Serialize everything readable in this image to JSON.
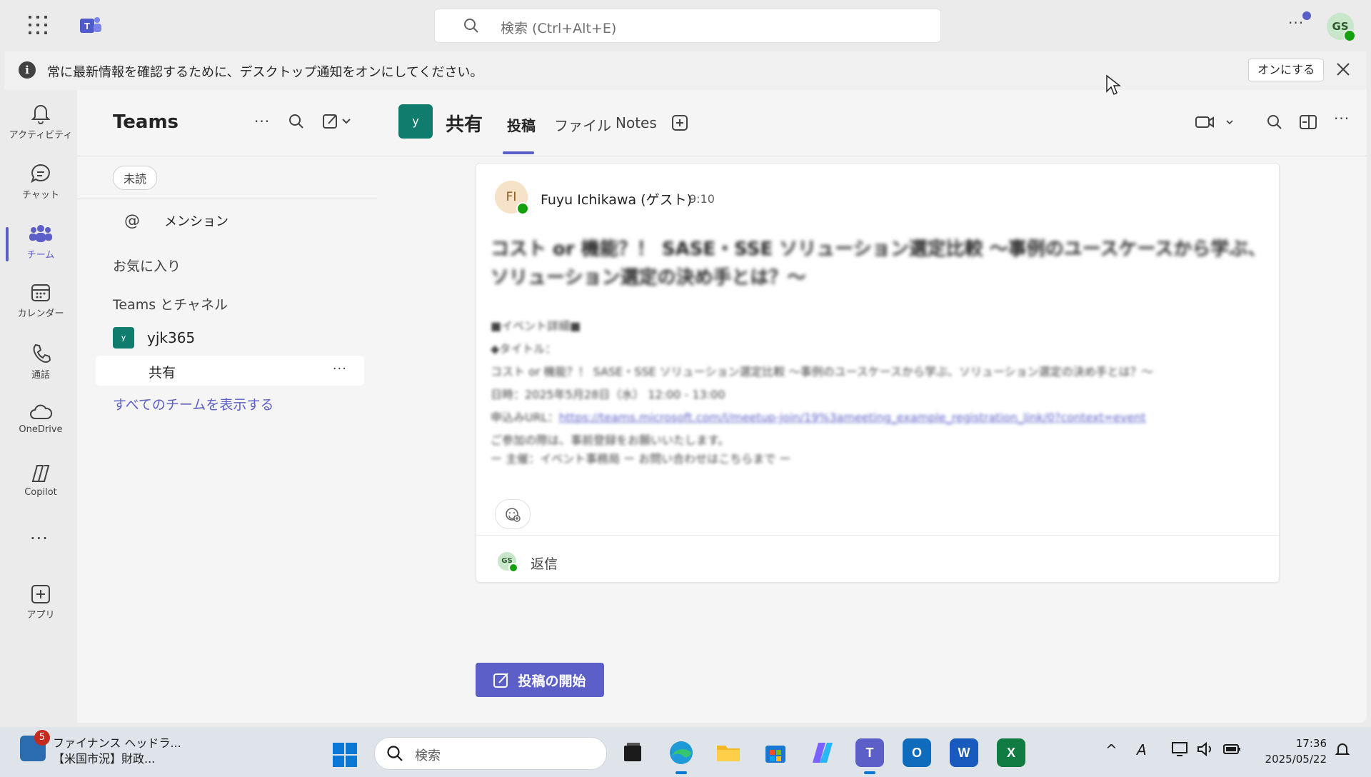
{
  "titlebar": {
    "search_placeholder": "検索 (Ctrl+Alt+E)",
    "more": "···",
    "avatar_initials": "GS"
  },
  "notification": {
    "message": "常に最新情報を確認するために、デスクトップ通知をオンにしてください。",
    "button": "オンにする"
  },
  "rail": {
    "items": [
      {
        "label": "アクティビティ",
        "icon": "bell-icon"
      },
      {
        "label": "チャット",
        "icon": "chat-icon"
      },
      {
        "label": "チーム",
        "icon": "teams-icon"
      },
      {
        "label": "カレンダー",
        "icon": "calendar-icon"
      },
      {
        "label": "通話",
        "icon": "phone-icon"
      },
      {
        "label": "OneDrive",
        "icon": "cloud-icon"
      },
      {
        "label": "Copilot",
        "icon": "copilot-icon"
      },
      {
        "label": "アプリ",
        "icon": "add-app-icon"
      }
    ],
    "more": "···"
  },
  "pane": {
    "title": "Teams",
    "more": "···",
    "filter_chip": "未読",
    "mention": "メンション",
    "favorites": "お気に入り",
    "teams_and_channels": "Teams とチャネル",
    "team_name": "yjk365",
    "team_tile": "y",
    "channel_name": "共有",
    "channel_more": "···",
    "show_all": "すべてのチームを表示する"
  },
  "channel": {
    "tile": "y",
    "name": "共有",
    "tabs": [
      "投稿",
      "ファイル",
      "Notes"
    ],
    "more": "···"
  },
  "post": {
    "avatar_initials": "FI",
    "author": "Fuyu Ichikawa (ゲスト)",
    "time": "9:10",
    "title": "コスト or 機能？！ SASE・SSE ソリューション選定比較 〜事例のユースケースから学ぶ、ソリューション選定の決め手とは？〜",
    "body_lines": [
      "■イベント詳細■",
      "◆タイトル：",
      "コスト or 機能？！ SASE・SSE ソリューション選定比較 〜事例のユースケースから学ぶ、ソリューション選定の決め手とは？〜",
      "日時：2025年5月28日（水） 12:00 - 13:00",
      "申込みURL："
    ],
    "link_text": "https://teams.microsoft.com/l/meetup-join/19%3ameeting_example_registration_link/0?context=event",
    "body_tail": [
      "ご参加の際は、事前登録をお願いいたします。",
      "ー 主催：イベント事務局 ー お問い合わせはこちらまで ー"
    ],
    "reply_avatar": "GS",
    "reply": "返信"
  },
  "new_post_button": "投稿の開始",
  "taskbar": {
    "news_badge": "5",
    "news_line1": "ファイナンス ヘッドラ...",
    "news_line2": "【米国市況】財政...",
    "search_placeholder": "検索",
    "apps": [
      {
        "name": "task-view-icon",
        "label": ""
      },
      {
        "name": "edge-icon",
        "label": ""
      },
      {
        "name": "file-explorer-icon",
        "label": ""
      },
      {
        "name": "store-icon",
        "label": ""
      },
      {
        "name": "copilot-app-icon",
        "label": ""
      },
      {
        "name": "teams-app-icon",
        "label": "T"
      },
      {
        "name": "outlook-icon",
        "label": "O"
      },
      {
        "name": "word-icon",
        "label": "W"
      },
      {
        "name": "excel-icon",
        "label": "X"
      }
    ],
    "time": "17:36",
    "date": "2025/05/22"
  },
  "colors": {
    "brand": "#5b5fc7",
    "team_tile": "#107c6e",
    "presence": "#13a10e"
  }
}
